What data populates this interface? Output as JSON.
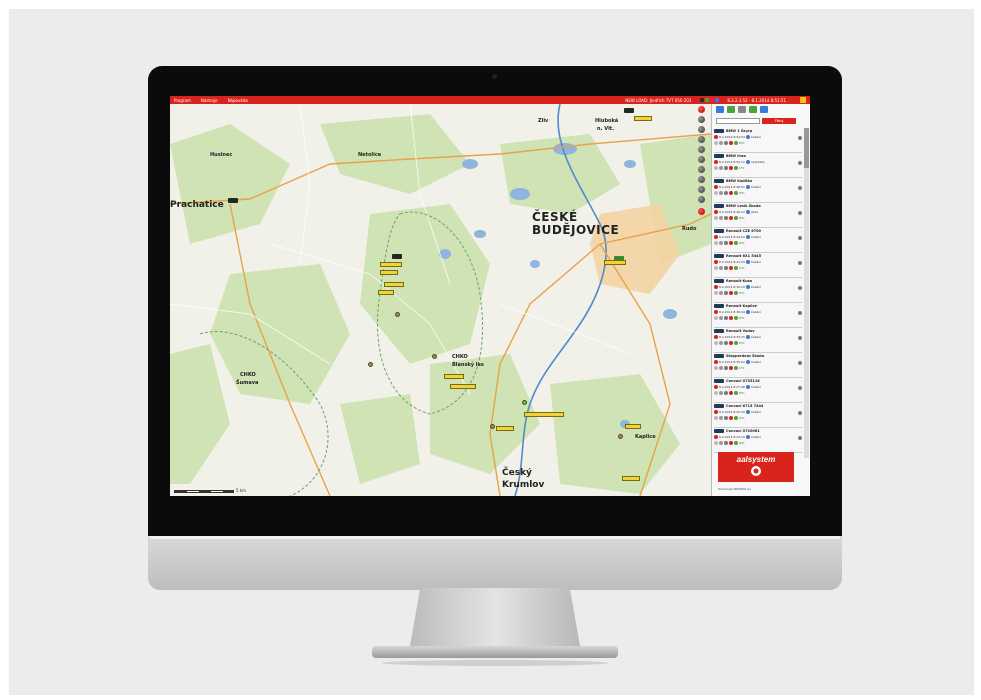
{
  "menu": {
    "items": [
      "Program",
      "Nástroje",
      "Nápověda"
    ],
    "status_text": "NEW LOAD: Jindřich TVT 050 203",
    "datetime": "8.3.2.3.52 · 8.1.2014 8:51:51"
  },
  "map": {
    "places": [
      {
        "name": "Husinec",
        "size": "small"
      },
      {
        "name": "Netolice",
        "size": "small"
      },
      {
        "name": "Zliv",
        "size": "small"
      },
      {
        "name": "Hluboká",
        "size": "small"
      },
      {
        "name": "n. Vlt.",
        "size": "small"
      },
      {
        "name": "Prachatice",
        "size": "med"
      },
      {
        "name": "ČESKÉ",
        "size": "big"
      },
      {
        "name": "BUDĚJOVICE",
        "size": "big"
      },
      {
        "name": "Rudo",
        "size": "small"
      },
      {
        "name": "CHKO",
        "size": "small"
      },
      {
        "name": "Blanský les",
        "size": "small"
      },
      {
        "name": "CHKO",
        "size": "small"
      },
      {
        "name": "Šumava",
        "size": "small"
      },
      {
        "name": "Český",
        "size": "med"
      },
      {
        "name": "Krumlov",
        "size": "med"
      },
      {
        "name": "Kaplice",
        "size": "small"
      }
    ],
    "scale_label": "5 km"
  },
  "sidebar": {
    "filter_placeholder": "",
    "filter_button": "Filtruj",
    "vehicles": [
      {
        "name": "BMW 1 Škyrp",
        "time": "8.2.2014 8:54:04",
        "status": "Čekání",
        "speed": "0°C"
      },
      {
        "name": "BMW Irwo",
        "time": "8.2.2014 8:52:11",
        "status": "Vykládka",
        "speed": "1°C"
      },
      {
        "name": "BMW Kaditka",
        "time": "8.2.2014 8:48:51",
        "status": "Čekání",
        "speed": "4°C"
      },
      {
        "name": "BMW Lesík Škoda",
        "time": "8.2.2014 8:46:12",
        "status": "Jízda",
        "speed": "0°C"
      },
      {
        "name": "Renault CZE 6700",
        "time": "8.2.2014 8:44:02",
        "status": "Čekání",
        "speed": "2°C"
      },
      {
        "name": "Renault 6X1 5445",
        "time": "8.2.2014 8:41:29",
        "status": "Čekání",
        "speed": "1°C"
      },
      {
        "name": "Renault Kuza",
        "time": "8.2.2014 8:39:10",
        "status": "Čekání",
        "speed": "3°C"
      },
      {
        "name": "Renault Kaplice",
        "time": "8.2.2014 8:36:44",
        "status": "Čekání",
        "speed": "0°C"
      },
      {
        "name": "Renault Vadov",
        "time": "8.2.2014 8:33:15",
        "status": "Čekání",
        "speed": "5°C"
      },
      {
        "name": "Stapperdorp Škoda",
        "time": "8.2.2014 8:30:02",
        "status": "Čekání",
        "speed": "1°C"
      },
      {
        "name": "Convoci 0735116",
        "time": "8.2.2014 8:27:48",
        "status": "Čekání",
        "speed": "0°C"
      },
      {
        "name": "Convoci 6715 7444",
        "time": "8.2.2014 8:25:30",
        "status": "Čekání",
        "speed": "2°C"
      },
      {
        "name": "Convoci 0720061",
        "time": "8.2.2014 8:22:19",
        "status": "Čekání",
        "speed": "4°C"
      }
    ],
    "logo_text": "aalsystem",
    "footer": "Provozuje",
    "footer_link": "SEKURIS.eu"
  },
  "colors": {
    "accent": "#d8241c",
    "map_forest": "#cfe3b4",
    "map_water": "#8fb4dd",
    "marker": "#f0d33b"
  }
}
